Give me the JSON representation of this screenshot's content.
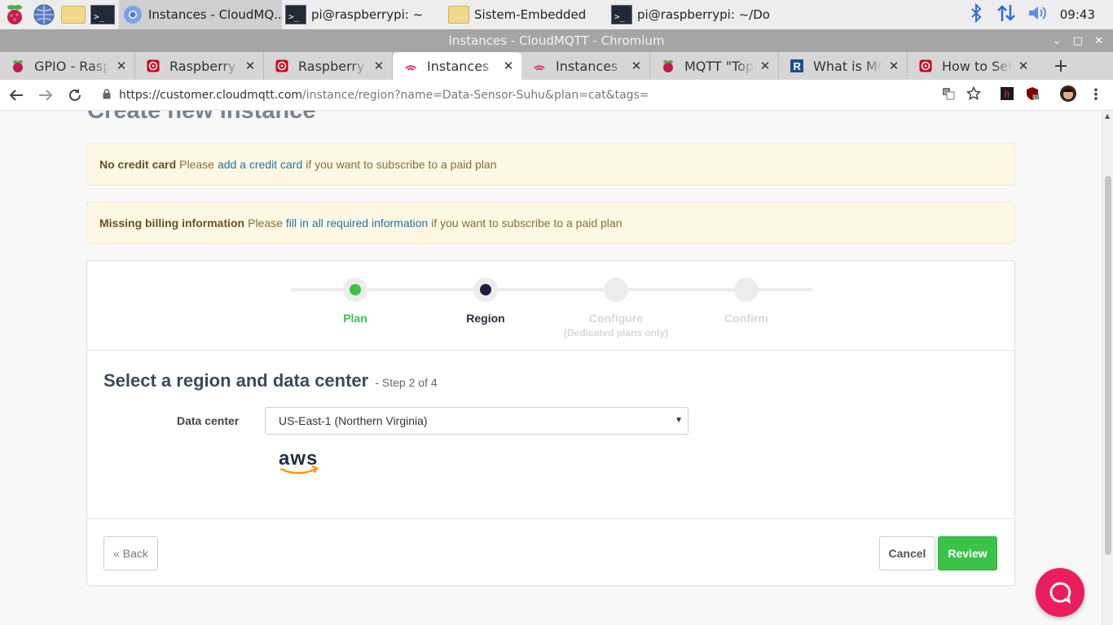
{
  "taskbar": {
    "tasks": [
      {
        "label": "Instances - CloudMQ...",
        "icon": "chromium-icon",
        "active": true
      },
      {
        "label": "pi@raspberrypi: ~",
        "icon": "terminal-icon"
      },
      {
        "label": "Sistem-Embedded",
        "icon": "folder-icon"
      },
      {
        "label": "pi@raspberrypi: ~/Do...",
        "icon": "terminal-icon"
      }
    ],
    "clock": "09:43"
  },
  "window": {
    "title": "Instances - CloudMQTT - Chromium"
  },
  "tabs": [
    {
      "label": "GPIO - Raspberry Pi",
      "icon": "raspberry-icon"
    },
    {
      "label": "Raspberry Pi",
      "icon": "target-icon"
    },
    {
      "label": "Raspberry-Pi",
      "icon": "target-icon"
    },
    {
      "label": "Instances - CloudMQTT",
      "icon": "cloudmqtt-icon",
      "active": true
    },
    {
      "label": "Instances - CloudMQTT",
      "icon": "cloudmqtt-icon"
    },
    {
      "label": "MQTT \"Topic\"",
      "icon": "raspberry-icon"
    },
    {
      "label": "What is MQTT",
      "icon": "r-icon"
    },
    {
      "label": "How to Setup",
      "icon": "target-icon"
    }
  ],
  "toolbar": {
    "url_host": "https://customer.cloudmqtt.com",
    "url_path": "/instance/region?name=Data-Sensor-Suhu&plan=cat&tags="
  },
  "page": {
    "title": "Create new instance",
    "alerts": [
      {
        "bold": "No credit card",
        "before": "Please",
        "link": "add a credit card",
        "after": "if you want to subscribe to a paid plan"
      },
      {
        "bold": "Missing billing information",
        "before": "Please",
        "link": "fill in all required information",
        "after": "if you want to subscribe to a paid plan"
      }
    ],
    "steps": [
      {
        "label": "Plan",
        "sub": "",
        "state": "done",
        "color": "#3ac249"
      },
      {
        "label": "Region",
        "sub": "",
        "state": "current",
        "color": "#1f1d3f"
      },
      {
        "label": "Configure",
        "sub": "(Dedicated plans only)",
        "state": "pending",
        "color": "#d7d7d7"
      },
      {
        "label": "Confirm",
        "sub": "",
        "state": "pending",
        "color": "#d7d7d7"
      }
    ],
    "section_title": "Select a region and data center",
    "section_sub": "- Step 2 of 4",
    "field_label": "Data center",
    "select_value": "US-East-1 (Northern Virginia)",
    "provider_logo": "aws",
    "buttons": {
      "back": "« Back",
      "cancel": "Cancel",
      "review": "Review"
    }
  }
}
